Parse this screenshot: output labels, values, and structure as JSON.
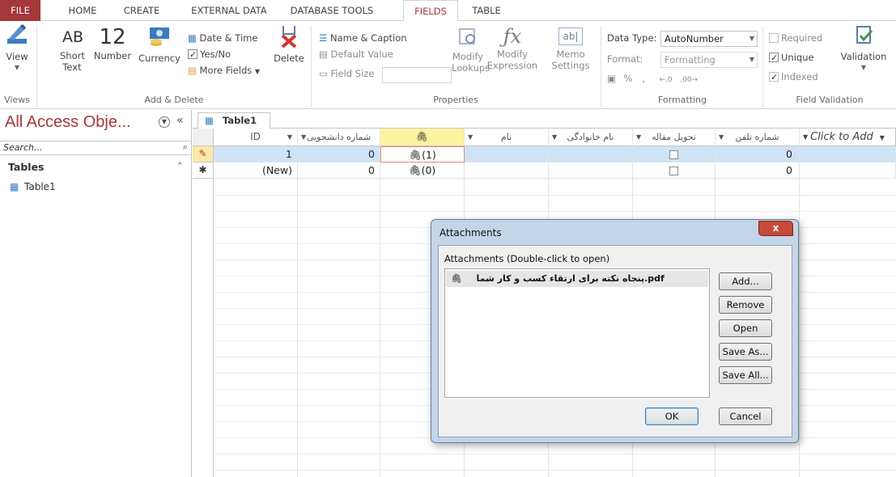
{
  "tabs": [
    "FILE",
    "HOME",
    "CREATE",
    "EXTERNAL DATA",
    "DATABASE TOOLS",
    "FIELDS",
    "TABLE"
  ],
  "ribbon": {
    "views": {
      "view_label": "View",
      "group": "Views"
    },
    "add_delete": {
      "short_text": "Short Text",
      "short_text_icon": "AB",
      "number": "Number",
      "number_icon": "12",
      "currency": "Currency",
      "date_time": "Date & Time",
      "yes_no": "Yes/No",
      "more_fields": "More Fields",
      "delete": "Delete",
      "group": "Add & Delete"
    },
    "properties": {
      "name_caption": "Name & Caption",
      "default_value": "Default Value",
      "field_size": "Field Size",
      "modify_lookups": "Modify Lookups",
      "modify_expression": "Modify Expression",
      "memo_settings": "Memo Settings",
      "group": "Properties"
    },
    "formatting": {
      "data_type_label": "Data Type:",
      "data_type_value": "AutoNumber",
      "format_label": "Format:",
      "format_value": "Formatting",
      "percent": "%",
      "comma": ",",
      "group": "Formatting"
    },
    "validation": {
      "required": "Required",
      "unique": "Unique",
      "indexed": "Indexed",
      "validation": "Validation",
      "group": "Field Validation"
    }
  },
  "nav": {
    "title": "All Access Obje...",
    "search_placeholder": "Search...",
    "section": "Tables",
    "items": [
      "Table1"
    ]
  },
  "doc_tab": "Table1",
  "columns": [
    "ID",
    "شماره دانشجویی",
    "",
    "نام",
    "نام خانوادگی",
    "تحویل مقاله",
    "شماره تلفن",
    "Click to Add"
  ],
  "rows": [
    {
      "id": "1",
      "student_no": "0",
      "attachment": "(1)",
      "phone": "0"
    },
    {
      "id": "(New)",
      "student_no": "0",
      "attachment": "(0)",
      "phone": "0"
    }
  ],
  "dialog": {
    "title": "Attachments",
    "close": "x",
    "caption": "Attachments (Double-click to open)",
    "files": [
      "پنجاه نکته برای ارتقاء کسب و کار شما.pdf"
    ],
    "buttons": {
      "add": "Add...",
      "remove": "Remove",
      "open": "Open",
      "save_as": "Save As...",
      "save_all": "Save All...",
      "ok": "OK",
      "cancel": "Cancel"
    }
  },
  "colors": {
    "accent": "#a4373a",
    "row_selected": "#cfe3f7",
    "header_selected": "#fff2a0"
  }
}
